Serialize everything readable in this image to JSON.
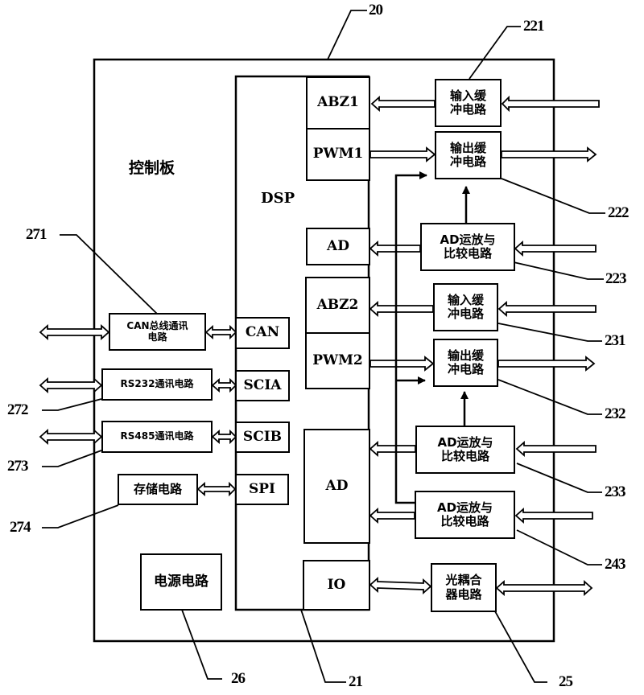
{
  "diagram": {
    "board_title": "控制板",
    "dsp_title": "DSP",
    "dsp_ports": {
      "abz1": "ABZ1",
      "pwm1": "PWM1",
      "ad1": "AD",
      "abz2": "ABZ2",
      "pwm2": "PWM2",
      "ad2": "AD",
      "io": "IO",
      "can": "CAN",
      "scia": "SCIA",
      "scib": "SCIB",
      "spi": "SPI"
    },
    "circuits": {
      "input_buffer_1": [
        "输入缓",
        "冲电路"
      ],
      "output_buffer_1": [
        "输出缓",
        "冲电路"
      ],
      "ad_compare_1": [
        "AD运放与",
        "比较电路"
      ],
      "input_buffer_2": [
        "输入缓",
        "冲电路"
      ],
      "output_buffer_2": [
        "输出缓",
        "冲电路"
      ],
      "ad_compare_2": [
        "AD运放与",
        "比较电路"
      ],
      "ad_compare_3": [
        "AD运放与",
        "比较电路"
      ],
      "optocoupler": [
        "光耦合",
        "器电路"
      ],
      "can_comm": [
        "CAN总线通讯",
        "电路"
      ],
      "rs232_comm": "RS232通讯电路",
      "rs485_comm": "RS485通讯电路",
      "storage": "存储电路",
      "power": "电源电路"
    },
    "reference_labels": {
      "board": "20",
      "dsp": "21",
      "input_buffer_1": "221",
      "output_buffer_1": "222",
      "ad_compare_1": "223",
      "input_buffer_2": "231",
      "output_buffer_2": "232",
      "ad_compare_2": "233",
      "ad_compare_3": "243",
      "optocoupler": "25",
      "power": "26",
      "can_comm": "271",
      "rs232_comm": "272",
      "rs485_comm": "273",
      "storage": "274"
    }
  }
}
